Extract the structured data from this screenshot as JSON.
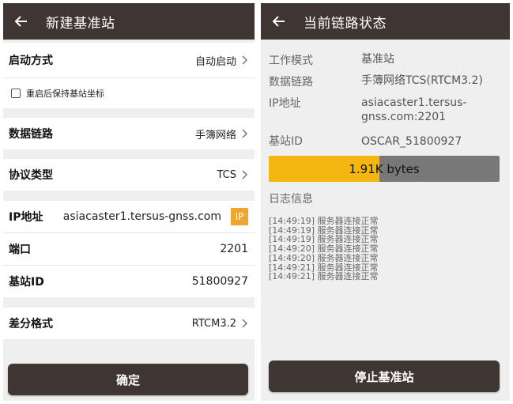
{
  "left": {
    "title": "新建基准站",
    "start_mode": {
      "label": "启动方式",
      "value": "自动启动"
    },
    "keep_coords": {
      "label": "重启后保持基站坐标",
      "checked": false
    },
    "data_link": {
      "label": "数据链路",
      "value": "手簿网络"
    },
    "protocol": {
      "label": "协议类型",
      "value": "TCS"
    },
    "ip": {
      "label": "IP地址",
      "value": "asiacaster1.tersus-gnss.com",
      "badge": "IP"
    },
    "port": {
      "label": "端口",
      "value": "2201"
    },
    "base_id": {
      "label": "基站ID",
      "value": "51800927"
    },
    "diff_format": {
      "label": "差分格式",
      "value": "RTCM3.2"
    },
    "confirm_button": "确定"
  },
  "right": {
    "title": "当前链路状态",
    "work_mode": {
      "label": "工作模式",
      "value": "基准站"
    },
    "data_link": {
      "label": "数据链路",
      "value": "手簿网络TCS(RTCM3.2)"
    },
    "ip": {
      "label": "IP地址",
      "value": "asiacaster1.tersus-gnss.com:2201"
    },
    "base_id": {
      "label": "基站ID",
      "value": "OSCAR_51800927"
    },
    "progress": {
      "text": "1.91K bytes",
      "fraction": 0.48
    },
    "log_title": "日志信息",
    "log_lines": [
      "[14:49:19] 服务器连接正常",
      "[14:49:19] 服务器连接正常",
      "[14:49:19] 服务器连接正常",
      "[14:49:20] 服务器连接正常",
      "[14:49:20] 服务器连接正常",
      "[14:49:21] 服务器连接正常",
      "[14:49:21] 服务器连接正常"
    ],
    "stop_button": "停止基准站"
  },
  "colors": {
    "header": "#3f3533",
    "accent": "#f0a531",
    "progress_fill": "#f4b711",
    "progress_track": "#787878"
  }
}
